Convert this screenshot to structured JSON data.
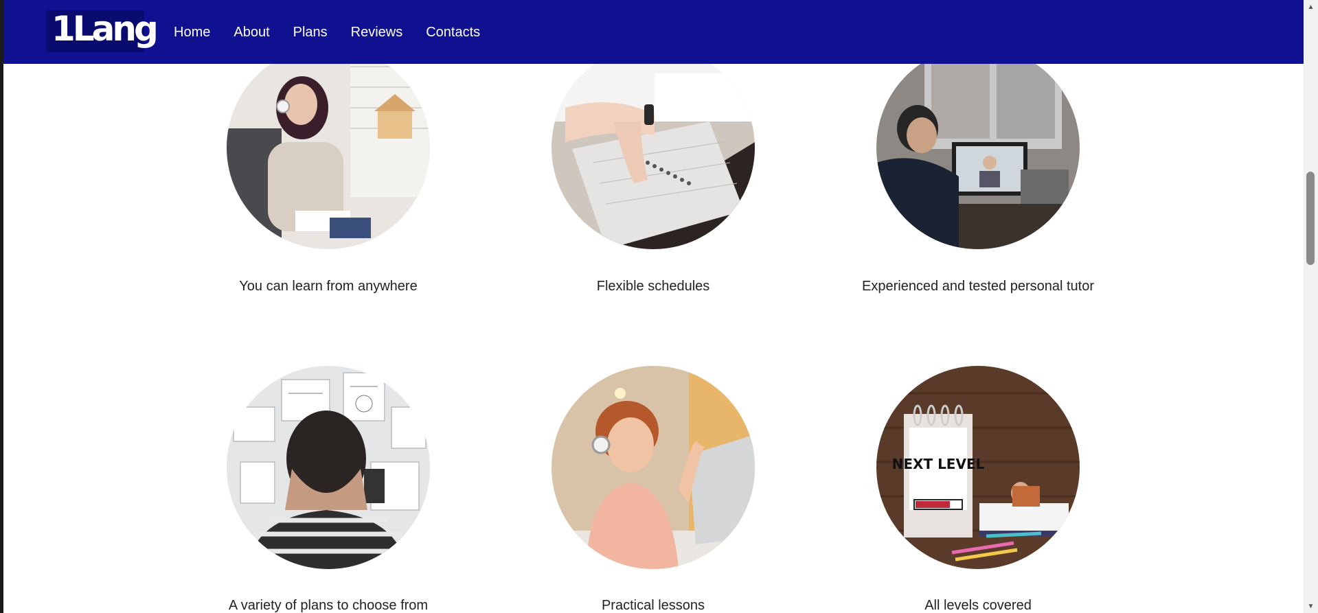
{
  "nav": {
    "logo": "1Lang",
    "links": [
      "Home",
      "About",
      "Plans",
      "Reviews",
      "Contacts"
    ]
  },
  "features": [
    {
      "caption": "You can learn from anywhere",
      "image": "woman-with-headphones-studying-photo"
    },
    {
      "caption": "Flexible schedules",
      "image": "hand-with-watch-notebook-photo"
    },
    {
      "caption": "Experienced and tested personal tutor",
      "image": "man-video-call-tutor-photo"
    },
    {
      "caption": "A variety of plans to choose from",
      "image": "man-viewing-planning-board-photo"
    },
    {
      "caption": "Practical lessons",
      "image": "boy-with-headset-laptop-photo"
    },
    {
      "caption": "All levels covered",
      "image": "next-level-calendar-photo"
    }
  ],
  "colors": {
    "navbar": "#0f1191",
    "logo_bg": "#0a0b6e",
    "text": "#222222"
  }
}
